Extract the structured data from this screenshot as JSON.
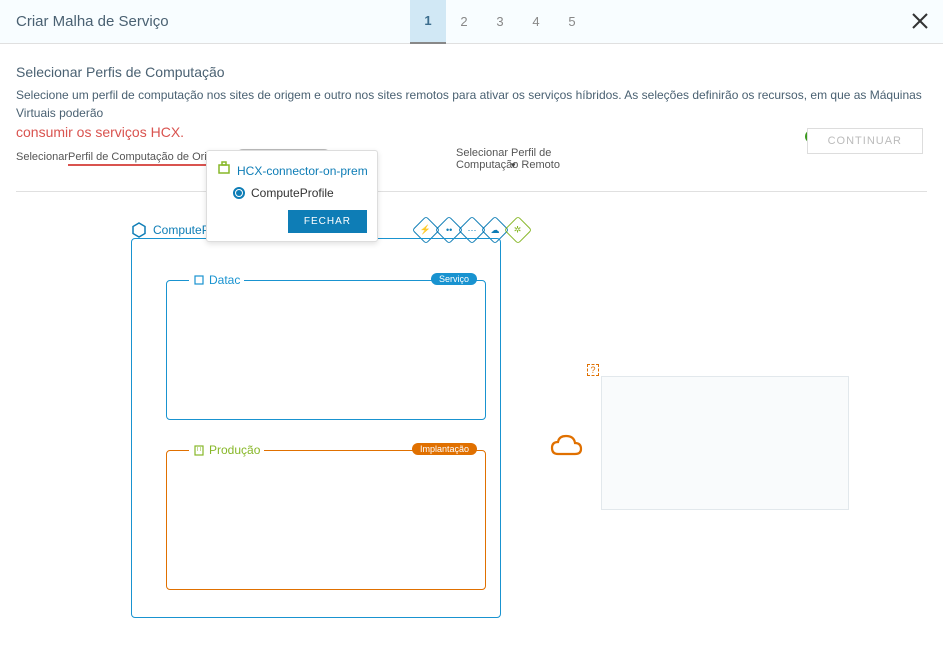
{
  "header": {
    "title": "Criar Malha de Serviço"
  },
  "steps": [
    "1",
    "2",
    "3",
    "4",
    "5"
  ],
  "section": {
    "subtitle": "Selecionar Perfis de Computação",
    "description": "Selecione um perfil de computação nos sites de origem e outro nos sites remotos para ativar os serviços híbridos. As seleções definirão os recursos, em que as Máquinas Virtuais poderão",
    "description2": "consumir os serviços HCX.",
    "origin_label_prefix": "Selecionar ",
    "origin_label": "Perfil de Computação de Origem",
    "origin_pill": "ComputeProfile",
    "remote_label": "Selecionar Perfil de Computação Remoto",
    "continue": "CONTINUAR"
  },
  "popover": {
    "site": "HCX-connector-on-prem",
    "option": "ComputeProfile",
    "close": "FECHAR"
  },
  "diagram": {
    "compute_name": "ComputeP",
    "block1_label": "Datac",
    "block1_badge": "Serviço",
    "block2_label": "Produção",
    "block2_badge": "Implantação",
    "question": "?"
  }
}
